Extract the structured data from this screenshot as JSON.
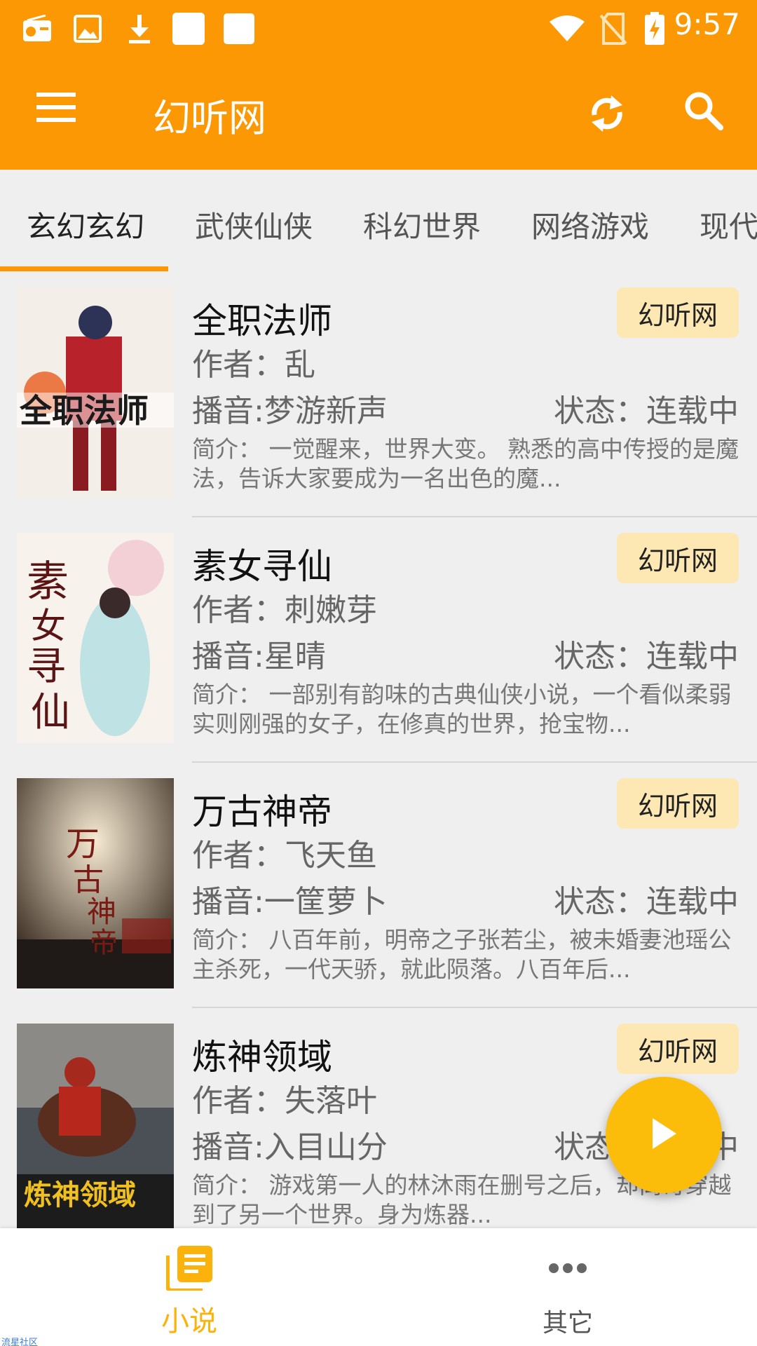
{
  "status_bar": {
    "time": "9:57",
    "icons": [
      "radio-icon",
      "image-icon",
      "download-icon",
      "app-square-icon",
      "app-square-icon",
      "wifi-icon",
      "no-sim-icon",
      "battery-charging-icon"
    ]
  },
  "app_bar": {
    "title": "幻听网",
    "menu_icon": "menu-icon",
    "refresh_icon": "refresh-icon",
    "search_icon": "search-icon",
    "color": "#fb9804"
  },
  "tabs": [
    {
      "label": "玄幻玄幻",
      "active": true
    },
    {
      "label": "武侠仙侠",
      "active": false
    },
    {
      "label": "科幻世界",
      "active": false
    },
    {
      "label": "网络游戏",
      "active": false
    },
    {
      "label": "现代",
      "active": false
    }
  ],
  "books": [
    {
      "title": "全职法师",
      "badge": "幻听网",
      "author": "作者：乱",
      "narrator": "播音:梦游新声",
      "status": "状态：连载中",
      "intro": "简介： 一觉醒来，世界大变。       熟悉的高中传授的是魔法，告诉大家要成为一名出色的魔..."
    },
    {
      "title": "素女寻仙",
      "badge": "幻听网",
      "author": "作者：刺嫩芽",
      "narrator": "播音:星晴",
      "status": "状态：连载中",
      "intro": "简介： 一部别有韵味的古典仙侠小说，一个看似柔弱实则刚强的女子，在修真的世界，抢宝物..."
    },
    {
      "title": "万古神帝",
      "badge": "幻听网",
      "author": "作者：飞天鱼",
      "narrator": "播音:一筐萝卜",
      "status": "状态：连载中",
      "intro": "简介： 八百年前，明帝之子张若尘，被未婚妻池瑶公主杀死，一代天骄，就此陨落。八百年后..."
    },
    {
      "title": "炼神领域",
      "badge": "幻听网",
      "author": "作者：失落叶",
      "narrator": "播音:入目山分",
      "status": "状态：连载中",
      "intro": "简介： 游戏第一人的林沐雨在删号之后，却离奇穿越到了另一个世界。身为炼器..."
    }
  ],
  "fab": {
    "icon": "play-icon",
    "color": "#fbbd0a"
  },
  "bottom_nav": [
    {
      "label": "小说",
      "icon": "book-list-icon",
      "active": true
    },
    {
      "label": "其它",
      "icon": "more-horizontal-icon",
      "active": false
    }
  ],
  "watermark": "流星社区"
}
